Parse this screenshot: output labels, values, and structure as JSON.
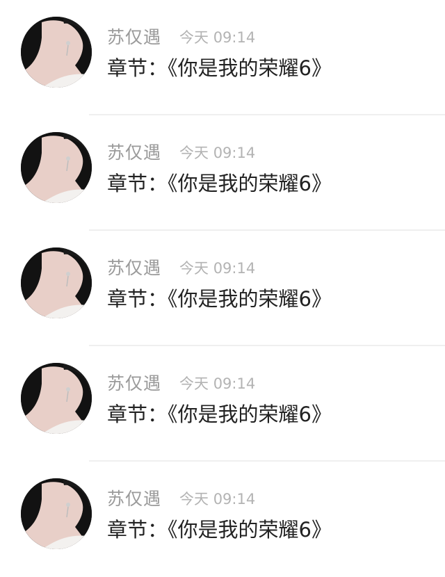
{
  "comments": [
    {
      "author": "苏仅遇",
      "date": "今天",
      "time": "09:14",
      "chapter": "章节：《你是我的荣耀6》",
      "avatar_icon": "avatar-portrait-icon"
    },
    {
      "author": "苏仅遇",
      "date": "今天",
      "time": "09:14",
      "chapter": "章节：《你是我的荣耀6》",
      "avatar_icon": "avatar-portrait-icon"
    },
    {
      "author": "苏仅遇",
      "date": "今天",
      "time": "09:14",
      "chapter": "章节：《你是我的荣耀6》",
      "avatar_icon": "avatar-portrait-icon"
    },
    {
      "author": "苏仅遇",
      "date": "今天",
      "time": "09:14",
      "chapter": "章节：《你是我的荣耀6》",
      "avatar_icon": "avatar-portrait-icon"
    },
    {
      "author": "苏仅遇",
      "date": "今天",
      "time": "09:14",
      "chapter": "章节：《你是我的荣耀6》",
      "avatar_icon": "avatar-portrait-icon"
    }
  ],
  "colors": {
    "author": "#9a9a9a",
    "timestamp": "#b3b3b3",
    "chapter_text": "#222222",
    "divider": "#efefef",
    "background": "#ffffff"
  }
}
